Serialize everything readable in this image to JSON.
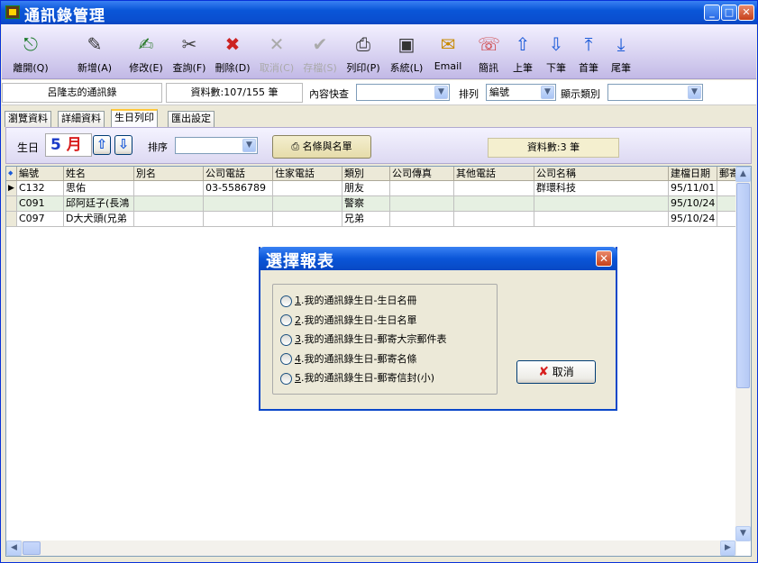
{
  "window": {
    "title": "通訊錄管理"
  },
  "toolbar": [
    {
      "key": "exit",
      "label": "離開(Q)",
      "icon": "exit-icon",
      "glyph": "⎋",
      "enabled": true
    },
    {
      "key": "add",
      "label": "新增(A)",
      "icon": "add-icon",
      "glyph": "✎",
      "enabled": true
    },
    {
      "key": "edit",
      "label": "修改(E)",
      "icon": "edit-icon",
      "glyph": "✍",
      "enabled": true
    },
    {
      "key": "query",
      "label": "查詢(F)",
      "icon": "query-icon",
      "glyph": "✂",
      "enabled": true
    },
    {
      "key": "delete",
      "label": "刪除(D)",
      "icon": "delete-icon",
      "glyph": "✖",
      "enabled": true
    },
    {
      "key": "cancel",
      "label": "取消(C)",
      "icon": "cancel-icon",
      "glyph": "✕",
      "enabled": false
    },
    {
      "key": "save",
      "label": "存檔(S)",
      "icon": "save-icon",
      "glyph": "✔",
      "enabled": false
    },
    {
      "key": "print",
      "label": "列印(P)",
      "icon": "print-icon",
      "glyph": "⎙",
      "enabled": true
    },
    {
      "key": "system",
      "label": "系統(L)",
      "icon": "system-icon",
      "glyph": "▣",
      "enabled": true
    },
    {
      "key": "email",
      "label": "Email",
      "icon": "email-icon",
      "glyph": "✉",
      "enabled": true
    },
    {
      "key": "sms",
      "label": "簡訊",
      "icon": "phone-icon",
      "glyph": "☏",
      "enabled": true
    },
    {
      "key": "prev",
      "label": "上筆",
      "icon": "arrow-up-icon",
      "glyph": "⇧",
      "enabled": true
    },
    {
      "key": "next",
      "label": "下筆",
      "icon": "arrow-down-icon",
      "glyph": "⇩",
      "enabled": true
    },
    {
      "key": "first",
      "label": "首筆",
      "icon": "arrow-first-icon",
      "glyph": "⤒",
      "enabled": true
    },
    {
      "key": "last",
      "label": "尾筆",
      "icon": "arrow-last-icon",
      "glyph": "⤓",
      "enabled": true
    }
  ],
  "info": {
    "book_name": "呂隆志的通訊錄",
    "record_count": "資料數:107/155 筆",
    "content_search_label": "內容快查",
    "content_search_value": "",
    "sort_label": "排列",
    "sort_value": "編號",
    "display_type_label": "顯示類別",
    "display_type_value": ""
  },
  "tabs": [
    {
      "label": "瀏覽資料",
      "active": false
    },
    {
      "label": "詳細資料",
      "active": false
    },
    {
      "label": "生日列印",
      "active": true
    },
    {
      "label": "匯出設定",
      "active": false
    }
  ],
  "birthday_panel": {
    "birthday_label": "生日",
    "month_number": "5",
    "month_unit": "月",
    "sort_label": "排序",
    "sort_value": "",
    "print_button": "名條與名單",
    "record_count": "資料數:3 筆"
  },
  "grid": {
    "columns": [
      "編號",
      "姓名",
      "別名",
      "公司電話",
      "住家電話",
      "類別",
      "公司傳真",
      "其他電話",
      "公司名稱",
      "建檔日期",
      "郵寄"
    ],
    "rows": [
      [
        "C132",
        "思佑",
        "",
        "03-5586789",
        "",
        "朋友",
        "",
        "",
        "群環科技",
        "95/11/01",
        ""
      ],
      [
        "C091",
        "邱阿廷子(長鴻",
        "",
        "",
        "",
        "警察",
        "",
        "",
        "",
        "95/10/24",
        ""
      ],
      [
        "C097",
        "D大犬頭(兄弟",
        "",
        "",
        "",
        "兄弟",
        "",
        "",
        "",
        "95/10/24",
        ""
      ]
    ],
    "current_row": 0,
    "colors": {
      "alt_row": "#e6f0e2",
      "header": "#ece9d8"
    }
  },
  "dialog": {
    "title": "選擇報表",
    "options": [
      {
        "num": "1",
        "text": ".我的通訊錄生日-生日名冊"
      },
      {
        "num": "2",
        "text": ".我的通訊錄生日-生日名單"
      },
      {
        "num": "3",
        "text": ".我的通訊錄生日-郵寄大宗郵件表"
      },
      {
        "num": "4",
        "text": ".我的通訊錄生日-郵寄名條"
      },
      {
        "num": "5",
        "text": ".我的通訊錄生日-郵寄信封(小)"
      }
    ],
    "cancel_label": "取消"
  }
}
